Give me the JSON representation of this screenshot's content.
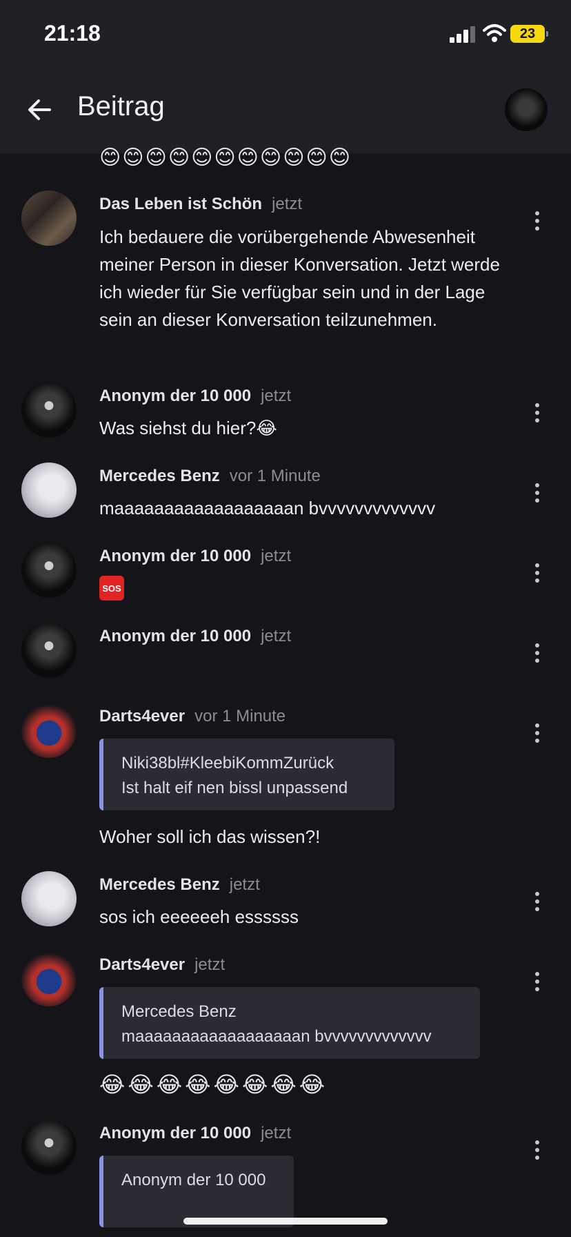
{
  "status_bar": {
    "time": "21:18",
    "battery": "23"
  },
  "header": {
    "title": "Beitrag"
  },
  "top_emojis": "😊😊😊😊😊😊😊😊😊😊😊",
  "comments": [
    {
      "author": "Das Leben ist Schön",
      "time": "jetzt",
      "text": "Ich bedauere die vorübergehende Abwesenheit meiner Person in dieser Konversation. Jetzt werde ich wieder für Sie verfügbar sein und in der Lage sein an dieser Konversation teilzunehmen."
    },
    {
      "author": "Anonym der 10 000",
      "time": "jetzt",
      "text": "Was siehst du hier?😂"
    },
    {
      "author": "Mercedes Benz",
      "time": "vor 1 Minute",
      "text": "maaaaaaaaaaaaaaaaaan bvvvvvvvvvvvvv"
    },
    {
      "author": "Anonym der 10 000",
      "time": "jetzt",
      "text": "SOS"
    },
    {
      "author": "Anonym der 10 000",
      "time": "jetzt",
      "text": ""
    },
    {
      "author": "Darts4ever",
      "time": "vor 1 Minute",
      "quote": {
        "author": "Niki38bl#KleebiKommZurück",
        "text": "Ist halt eif nen bissl unpassend"
      },
      "text": "Woher soll ich das wissen?!"
    },
    {
      "author": "Mercedes Benz",
      "time": "jetzt",
      "text": "sos ich eeeeeeh essssss"
    },
    {
      "author": "Darts4ever",
      "time": "jetzt",
      "quote": {
        "author": "Mercedes Benz",
        "text": "maaaaaaaaaaaaaaaaaan bvvvvvvvvvvvvv"
      },
      "text": "😂😂😂😂😂😂😂😂"
    },
    {
      "author": "Anonym der 10 000",
      "time": "jetzt",
      "quote": {
        "author": "Anonym der 10 000",
        "text": ""
      }
    }
  ]
}
